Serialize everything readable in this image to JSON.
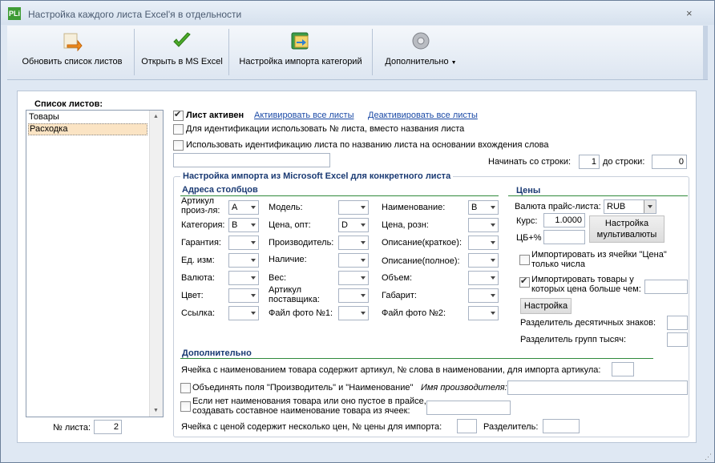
{
  "window": {
    "title": "Настройка каждого листа Excel'я в отдельности",
    "app_icon": "PLi",
    "close": "×"
  },
  "toolbar": {
    "refresh": "Обновить список листов",
    "open_excel": "Открыть в MS Excel",
    "category_import": "Настройка импорта категорий",
    "more": "Дополнительно"
  },
  "sheets": {
    "label": "Список листов:",
    "items": [
      "Товары",
      "Расходка"
    ],
    "selected": 1,
    "number_label": "№ листа:",
    "number_value": "2"
  },
  "top": {
    "active_label": "Лист активен",
    "activate_all": "Активировать все листы",
    "deactivate_all": "Деактивировать все листы",
    "use_number": "Для идентификации использовать № листа, вместо названия листа",
    "use_name_match": "Использовать идентификацию листа по названию листа на основании вхождения слова",
    "match_value": "",
    "start_row_label": "Начинать со строки:",
    "start_row": "1",
    "end_row_label": "до строки:",
    "end_row": "0"
  },
  "import": {
    "section_title": "Настройка импорта из Microsoft Excel для конкретного листа",
    "columns_title": "Адреса столбцов",
    "columns": [
      {
        "label": "Артикул произ-ля:",
        "value": "A"
      },
      {
        "label": "Категория:",
        "value": "B"
      },
      {
        "label": "Гарантия:",
        "value": ""
      },
      {
        "label": "Ед. изм:",
        "value": ""
      },
      {
        "label": "Валюта:",
        "value": ""
      },
      {
        "label": "Цвет:",
        "value": ""
      },
      {
        "label": "Ссылка:",
        "value": ""
      },
      {
        "label": "Модель:",
        "value": ""
      },
      {
        "label": "Цена, опт:",
        "value": "D"
      },
      {
        "label": "Производитель:",
        "value": ""
      },
      {
        "label": "Наличие:",
        "value": ""
      },
      {
        "label": "Вес:",
        "value": ""
      },
      {
        "label": "Артикул поставщика:",
        "value": ""
      },
      {
        "label": "Файл фото №1:",
        "value": ""
      },
      {
        "label": "Наименование:",
        "value": "B"
      },
      {
        "label": "Цена, розн:",
        "value": ""
      },
      {
        "label": "Описание(краткое):",
        "value": ""
      },
      {
        "label": "Описание(полное):",
        "value": ""
      },
      {
        "label": "Объем:",
        "value": ""
      },
      {
        "label": "Габарит:",
        "value": ""
      },
      {
        "label": "Файл фото №2:",
        "value": ""
      }
    ]
  },
  "prices": {
    "title": "Цены",
    "currency_label": "Валюта прайс-листа:",
    "currency": "RUB",
    "rate_label": "Курс:",
    "rate": "1.0000",
    "cb_label": "ЦБ+%",
    "cb_value": "",
    "multicurrency": "Настройка мультивалюты",
    "only_numbers": "Импортировать из ячейки \"Цена\" только числа",
    "price_greater": "Импортировать товары у которых цена больше чем:",
    "price_greater_value": "",
    "settings_btn": "Настройка",
    "decimal_sep": "Разделитель десятичных знаков:",
    "decimal_value": "",
    "group_sep": "Разделитель групп тысяч:",
    "group_value": ""
  },
  "extra": {
    "title": "Дополнительно",
    "article_in_name": "Ячейка с наименованием товара содержит артикул, № слова в наименовании, для импорта артикула:",
    "article_in_name_value": "",
    "merge_fields": "Объединять поля \"Производитель\" и \"Наименование\"",
    "manufacturer_name_label": "Имя производителя:",
    "manufacturer_name_value": "",
    "compose_name": "Если нет наименования товара или оно пустое в прайсе, создавать составное наименование товара из ячеек:",
    "compose_name_value": "",
    "multi_price": "Ячейка с ценой содержит несколько цен, № цены для импорта:",
    "multi_price_value": "",
    "separator_label": "Разделитель:",
    "separator_value": ""
  }
}
